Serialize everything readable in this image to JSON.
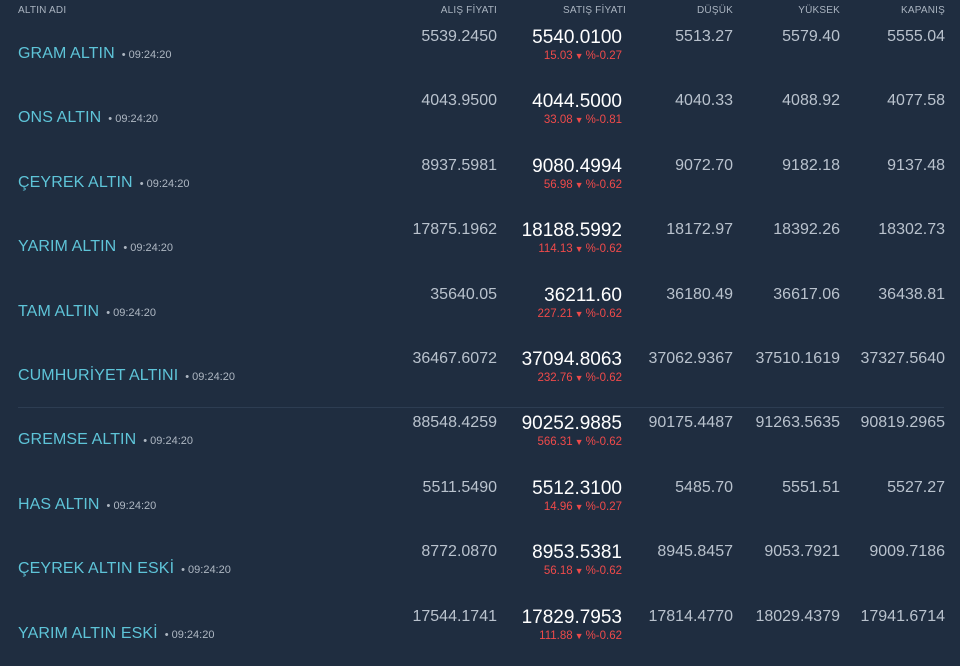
{
  "headers": {
    "name": "ALTIN ADI",
    "alis": "ALIŞ FİYATI",
    "satis": "SATIŞ FİYATI",
    "dusuk": "DÜŞÜK",
    "yuksek": "YÜKSEK",
    "kapanis": "KAPANIŞ"
  },
  "colors": {
    "background": "#1f2d40",
    "name": "#5ec4d8",
    "down": "#ef4a4a",
    "sell": "#ffffff"
  },
  "rows": [
    {
      "name": "GRAM ALTIN",
      "time": "• 09:24:20",
      "alis": "5539.2450",
      "satis": "5540.0100",
      "change": "15.03",
      "pct": "%-0.27",
      "dusuk": "5513.27",
      "yuksek": "5579.40",
      "kapanis": "5555.04"
    },
    {
      "name": "ONS ALTIN",
      "time": "• 09:24:20",
      "alis": "4043.9500",
      "satis": "4044.5000",
      "change": "33.08",
      "pct": "%-0.81",
      "dusuk": "4040.33",
      "yuksek": "4088.92",
      "kapanis": "4077.58"
    },
    {
      "name": "ÇEYREK ALTIN",
      "time": "• 09:24:20",
      "alis": "8937.5981",
      "satis": "9080.4994",
      "change": "56.98",
      "pct": "%-0.62",
      "dusuk": "9072.70",
      "yuksek": "9182.18",
      "kapanis": "9137.48"
    },
    {
      "name": "YARIM ALTIN",
      "time": "• 09:24:20",
      "alis": "17875.1962",
      "satis": "18188.5992",
      "change": "114.13",
      "pct": "%-0.62",
      "dusuk": "18172.97",
      "yuksek": "18392.26",
      "kapanis": "18302.73"
    },
    {
      "name": "TAM ALTIN",
      "time": "• 09:24:20",
      "alis": "35640.05",
      "satis": "36211.60",
      "change": "227.21",
      "pct": "%-0.62",
      "dusuk": "36180.49",
      "yuksek": "36617.06",
      "kapanis": "36438.81"
    },
    {
      "name": "CUMHURİYET ALTINI",
      "time": "• 09:24:20",
      "alis": "36467.6072",
      "satis": "37094.8063",
      "change": "232.76",
      "pct": "%-0.62",
      "dusuk": "37062.9367",
      "yuksek": "37510.1619",
      "kapanis": "37327.5640"
    },
    {
      "name": "GREMSE ALTIN",
      "time": "• 09:24:20",
      "alis": "88548.4259",
      "satis": "90252.9885",
      "change": "566.31",
      "pct": "%-0.62",
      "dusuk": "90175.4487",
      "yuksek": "91263.5635",
      "kapanis": "90819.2965"
    },
    {
      "name": "HAS ALTIN",
      "time": "• 09:24:20",
      "alis": "5511.5490",
      "satis": "5512.3100",
      "change": "14.96",
      "pct": "%-0.27",
      "dusuk": "5485.70",
      "yuksek": "5551.51",
      "kapanis": "5527.27"
    },
    {
      "name": "ÇEYREK ALTIN ESKİ",
      "time": "• 09:24:20",
      "alis": "8772.0870",
      "satis": "8953.5381",
      "change": "56.18",
      "pct": "%-0.62",
      "dusuk": "8945.8457",
      "yuksek": "9053.7921",
      "kapanis": "9009.7186"
    },
    {
      "name": "YARIM ALTIN ESKİ",
      "time": "• 09:24:20",
      "alis": "17544.1741",
      "satis": "17829.7953",
      "change": "111.88",
      "pct": "%-0.62",
      "dusuk": "17814.4770",
      "yuksek": "18029.4379",
      "kapanis": "17941.6714"
    }
  ]
}
